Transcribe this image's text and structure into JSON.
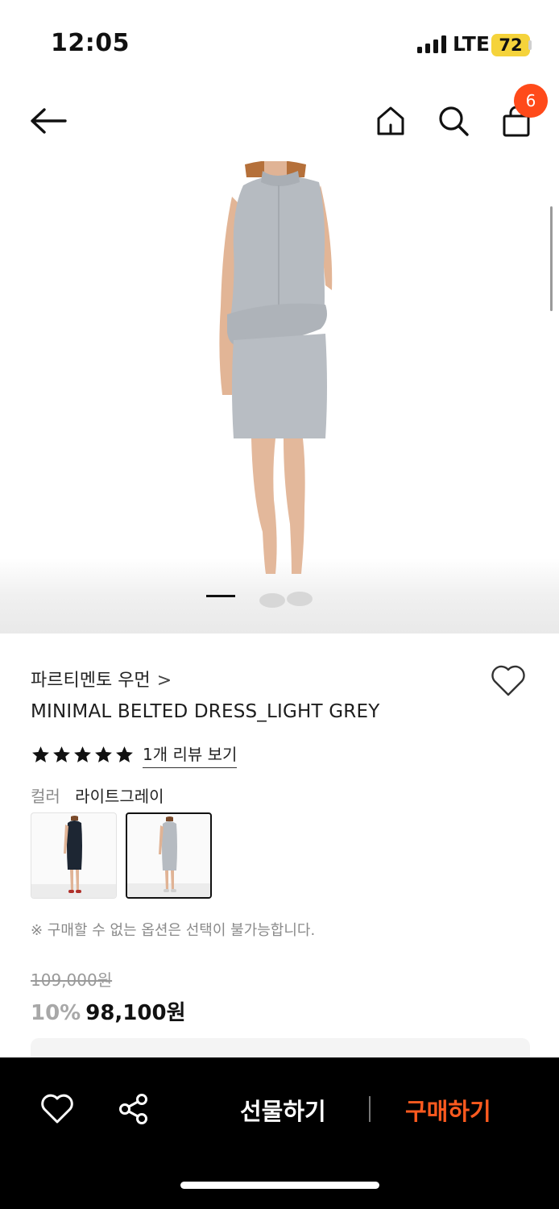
{
  "status_bar": {
    "time": "12:05",
    "network": "LTE",
    "battery": "72"
  },
  "nav": {
    "back_icon": "arrow-left-icon",
    "home_icon": "home-icon",
    "search_icon": "search-icon",
    "cart_icon": "shopping-bag-icon",
    "cart_count": "6"
  },
  "product": {
    "brand": "파르티멘토 우먼",
    "brand_chevron": ">",
    "title": "MINIMAL BELTED DRESS_LIGHT GREY",
    "rating_stars": 5,
    "review_link": "1개 리뷰 보기",
    "color_label": "컬러",
    "color_value": "라이트그레이",
    "swatches": [
      {
        "name": "navy dress",
        "selected": false
      },
      {
        "name": "light grey dress",
        "selected": true
      }
    ],
    "notice": "※ 구매할 수 없는 옵션은 선택이 불가능합니다.",
    "original_price": "109,000원",
    "discount": "10%",
    "sale_price": "98,100원"
  },
  "bottom_bar": {
    "wishlist_icon": "heart-outline-icon",
    "share_icon": "share-icon",
    "gift_label": "선물하기",
    "buy_label": "구매하기"
  },
  "colors": {
    "accent": "#ff5a1f",
    "badge": "#ff4a1a",
    "battery": "#f5d33b",
    "dress_grey": "#b4b9bf",
    "dress_navy": "#1d2633"
  }
}
